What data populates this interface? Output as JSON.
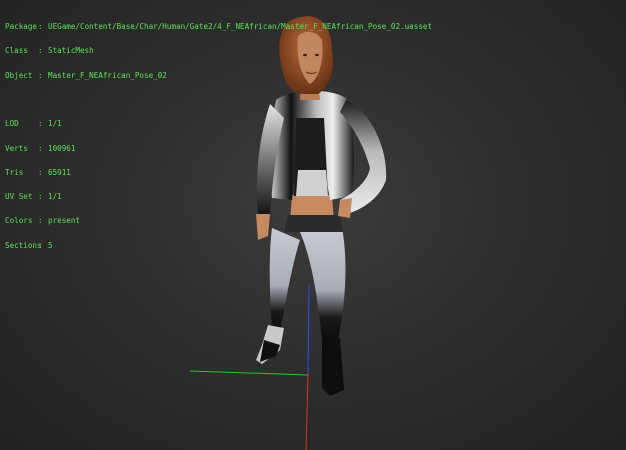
{
  "info": {
    "package_label": "Package",
    "package_value": "UEGame/Content/Base/Char/Human/Gate2/4_F_NEAfrican/Master_F_NEAfrican_Pose_02.uasset",
    "class_label": "Class",
    "class_value": "StaticMesh",
    "object_label": "Object",
    "object_value": "Master_F_NEAfrican_Pose_02",
    "lod_label": "LOD",
    "lod_value": "1/1",
    "verts_label": "Verts",
    "verts_value": "100961",
    "tris_label": "Tris",
    "tris_value": "65911",
    "uvset_label": "UV Set",
    "uvset_value": "1/1",
    "colors_label": "Colors",
    "colors_value": "present",
    "sections_label": "Sections",
    "sections_value": "5",
    "separator": ":"
  },
  "colors": {
    "overlay_text": "#5fe05f",
    "axis_x": "#e03030",
    "axis_y": "#30c030",
    "axis_z": "#3050e0"
  }
}
